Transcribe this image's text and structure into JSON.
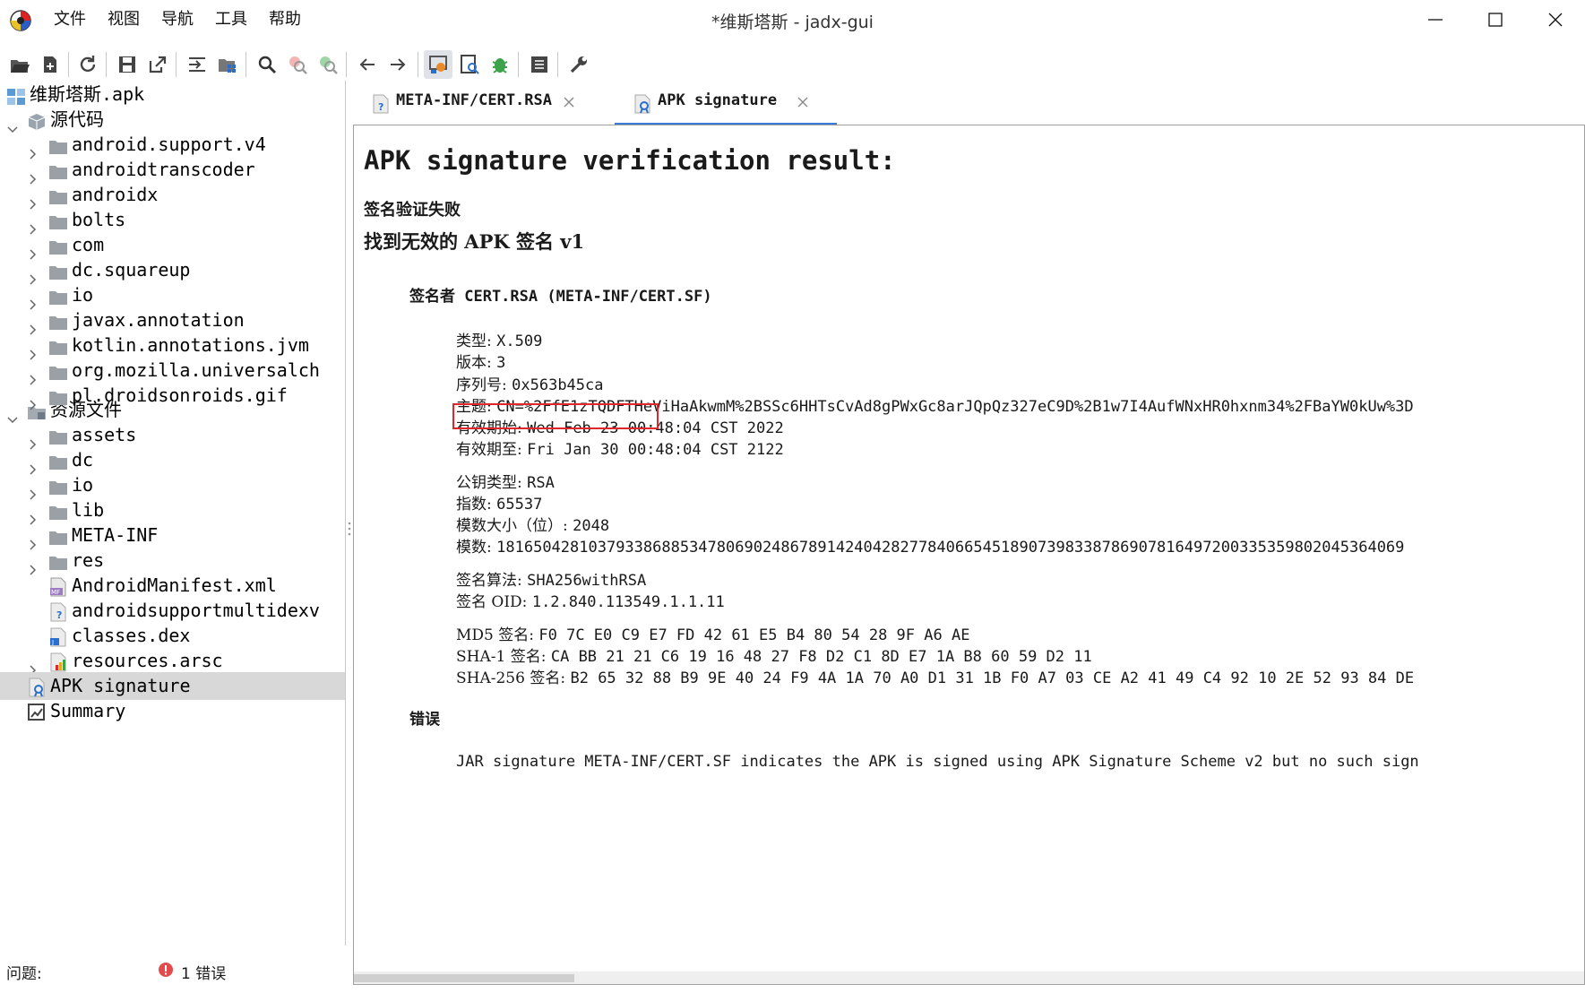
{
  "window": {
    "title": "*维斯塔斯 - jadx-gui",
    "controls": [
      "minimize",
      "maximize",
      "close"
    ]
  },
  "menu": [
    "文件",
    "视图",
    "导航",
    "工具",
    "帮助"
  ],
  "toolbar": {
    "icons": [
      "open-file-icon",
      "add-file-icon",
      "reload-icon",
      "save-icon",
      "export-icon",
      "sync-code-icon",
      "flatten-packages-icon",
      "search-icon",
      "find-usage-icon",
      "find-class-icon",
      "back-icon",
      "forward-icon",
      "deobfuscation-icon",
      "quark-icon",
      "debugger-icon",
      "log-icon",
      "preferences-icon"
    ]
  },
  "tree": {
    "root": "维斯塔斯.apk",
    "source_node": "源代码",
    "source_packages": [
      "android.support.v4",
      "androidtranscoder",
      "androidx",
      "bolts",
      "com",
      "dc.squareup",
      "io",
      "javax.annotation",
      "kotlin.annotations.jvm",
      "org.mozilla.universalch",
      "pl.droidsonroids.gif"
    ],
    "resources_node": "资源文件",
    "resource_folders": [
      "assets",
      "dc",
      "io",
      "lib",
      "META-INF",
      "res"
    ],
    "resource_files": [
      "AndroidManifest.xml",
      "androidsupportmultidexv",
      "classes.dex",
      "resources.arsc"
    ],
    "apk_signature": "APK signature",
    "summary": "Summary",
    "selected": "APK signature"
  },
  "tabs": [
    {
      "label": "META-INF/CERT.RSA",
      "active": false
    },
    {
      "label": "APK signature",
      "active": true
    }
  ],
  "content": {
    "title": "APK signature verification result:",
    "status": "签名验证失败",
    "finding": "找到无效的 APK 签名 v1",
    "signer": "签名者 CERT.RSA (META-INF/CERT.SF)",
    "cert": {
      "type_k": "类型:",
      "type_v": "X.509",
      "version_k": "版本:",
      "version_v": "3",
      "serial_k": "序列号:",
      "serial_v": "0x563b45ca",
      "subject_k": "主题:",
      "subject_v": "CN=%2FfE1zTQDFTHeViHaAkwmM%2BSSc6HHTsCvAd8gPWxGc8arJQpQz327eC9D%2B1w7I4AufWNxHR0hxnm34%2FBaYW0kUw%3D",
      "valid_from_k": "有效期始:",
      "valid_from_v": "Wed Feb 23 00:48:04 CST 2022",
      "valid_to_k": "有效期至:",
      "valid_to_v": "Fri Jan 30 00:48:04 CST 2122"
    },
    "key": {
      "pubkey_type_k": "公钥类型:",
      "pubkey_type_v": "RSA",
      "exponent_k": "指数:",
      "exponent_v": "65537",
      "modulus_size_k": "模数大小（位）:",
      "modulus_size_v": "2048",
      "modulus_k": "模数:",
      "modulus_v": "181650428103793386885347806902486789142404282778406654518907398338786907816497200335359802045364069"
    },
    "sig_alg": {
      "alg_k": "签名算法:",
      "alg_v": "SHA256withRSA",
      "oid_k": "签名 OID:",
      "oid_v": "1.2.840.113549.1.1.11"
    },
    "digests": {
      "md5_k": "MD5 签名:",
      "md5_v": "F0 7C E0 C9 E7 FD 42 61 E5 B4 80 54 28 9F A6 AE",
      "sha1_k": "SHA-1 签名:",
      "sha1_v": "CA BB 21 21 C6 19 16 48 27 F8 D2 C1 8D E7 1A B8 60 59 D2 11",
      "sha256_k": "SHA-256 签名:",
      "sha256_v": "B2 65 32 88 B9 9E 40 24 F9 4A 1A 70 A0 D1 31 1B F0 A7 03 CE A2 41 49 C4 92 10 2E 52 93 84 DE"
    },
    "errors_heading": "错误",
    "error_text": "JAR signature META-INF/CERT.SF indicates the APK is signed using APK Signature Scheme v2 but no such sign"
  },
  "statusbar": {
    "label": "问题:",
    "errors": "1 错误"
  },
  "colors": {
    "highlight_box": "#e0252b",
    "active_tab_underline": "#3a7bd5",
    "selected_row": "#d8d8d8",
    "error_red": "#e24b4b"
  }
}
